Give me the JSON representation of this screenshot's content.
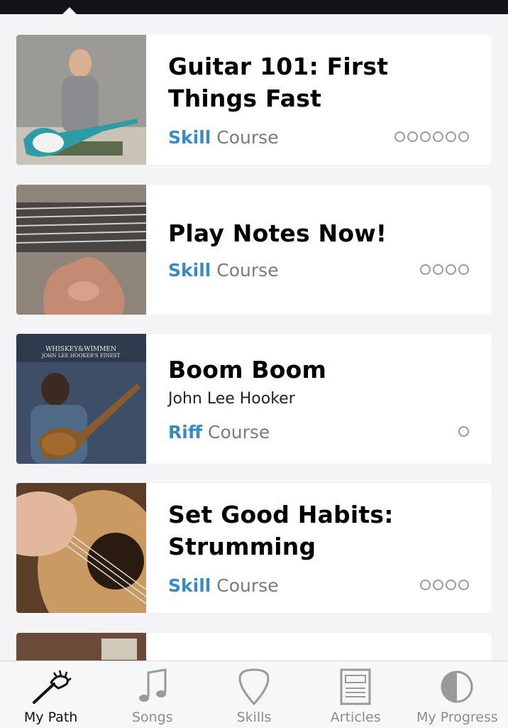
{
  "feed": {
    "cards": [
      {
        "title": "Guitar 101: First Things Fast",
        "type": "Skill",
        "kind": "Course",
        "progress_steps": 6,
        "thumbnail": "guitar-player-thumbnail"
      },
      {
        "title": "Play Notes Now!",
        "type": "Skill",
        "kind": "Course",
        "progress_steps": 4,
        "thumbnail": "fretboard-hand-thumbnail"
      },
      {
        "title": "Boom Boom",
        "subtitle": "John Lee Hooker",
        "type": "Riff",
        "kind": "Course",
        "progress_steps": 1,
        "thumbnail": "album-cover-thumbnail",
        "album_text_line1": "WHISKEY&WIMMEN",
        "album_text_line2": "JOHN LEE HOOKER'S FINEST"
      },
      {
        "title": "Set Good Habits: Strumming",
        "type": "Skill",
        "kind": "Course",
        "progress_steps": 4,
        "thumbnail": "strumming-hand-thumbnail"
      }
    ]
  },
  "tabs": [
    {
      "label": "My Path",
      "icon": "guitar-headstock-icon",
      "active": true
    },
    {
      "label": "Songs",
      "icon": "music-note-icon",
      "active": false
    },
    {
      "label": "Skills",
      "icon": "guitar-pick-icon",
      "active": false
    },
    {
      "label": "Articles",
      "icon": "newspaper-icon",
      "active": false
    },
    {
      "label": "My Progress",
      "icon": "half-circle-icon",
      "active": false
    }
  ],
  "colors": {
    "accent": "#3a8ac6",
    "muted": "#7a7a7a",
    "background": "#f4f4f6",
    "top_bar": "#121417"
  }
}
